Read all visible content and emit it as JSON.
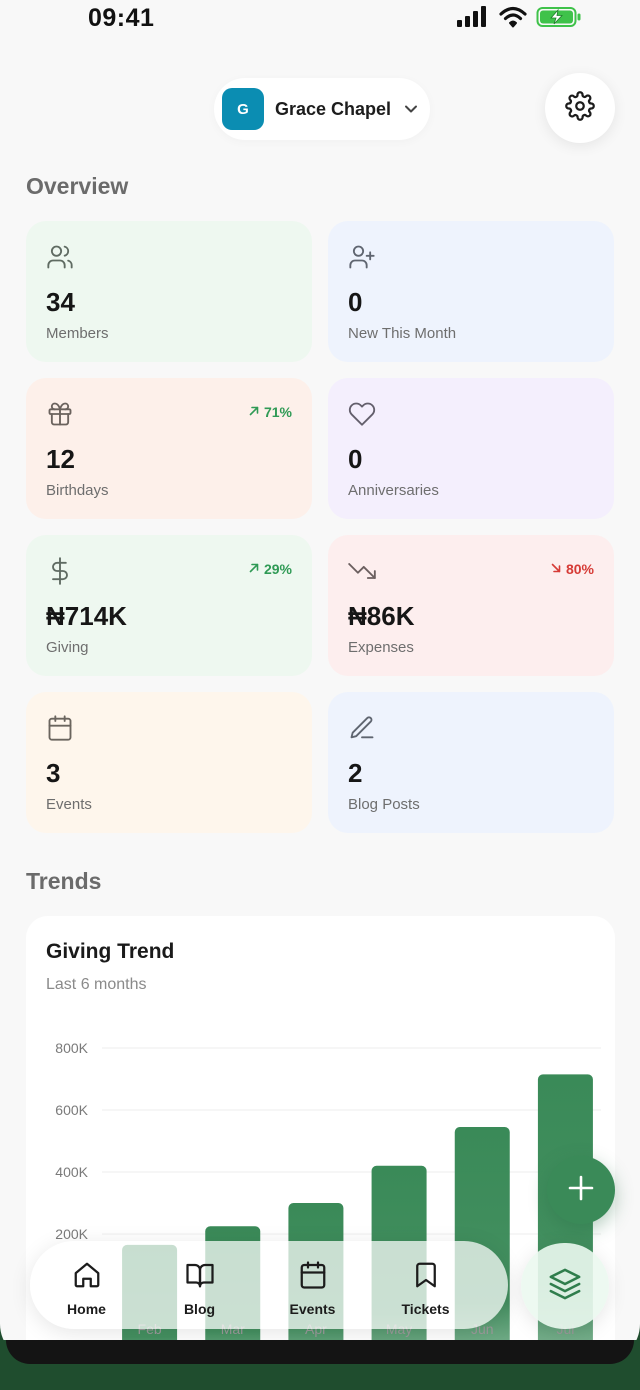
{
  "status_bar": {
    "time": "09:41"
  },
  "header": {
    "org_initial": "G",
    "org_name": "Grace Chapel"
  },
  "overview": {
    "title": "Overview",
    "cards": [
      {
        "icon": "users-icon",
        "value": "34",
        "label": "Members",
        "bg": "#eef8f0",
        "icon_color": "#5f6b62"
      },
      {
        "icon": "user-plus-icon",
        "value": "0",
        "label": "New This Month",
        "bg": "#eef3fd",
        "icon_color": "#5f6570"
      },
      {
        "icon": "gift-icon",
        "value": "12",
        "label": "Birthdays",
        "trend": "71%",
        "trend_dir": "up",
        "bg": "#fdf0ea",
        "icon_color": "#6a625d"
      },
      {
        "icon": "heart-icon",
        "value": "0",
        "label": "Anniversaries",
        "bg": "#f4effd",
        "icon_color": "#635f6c"
      },
      {
        "icon": "dollar-icon",
        "value": "₦714K",
        "label": "Giving",
        "trend": "29%",
        "trend_dir": "up",
        "bg": "#eef8f0",
        "icon_color": "#5f6b62"
      },
      {
        "icon": "trending-down-icon",
        "value": "₦86K",
        "label": "Expenses",
        "trend": "80%",
        "trend_dir": "down",
        "bg": "#fdeeee",
        "icon_color": "#6b5f5f"
      },
      {
        "icon": "calendar-icon",
        "value": "3",
        "label": "Events",
        "bg": "#fef6ec",
        "icon_color": "#6a655e"
      },
      {
        "icon": "pen-icon",
        "value": "2",
        "label": "Blog Posts",
        "bg": "#eef3fd",
        "icon_color": "#5f6570"
      }
    ]
  },
  "trends": {
    "title": "Trends",
    "chart_card_title": "Giving Trend",
    "chart_card_subtitle": "Last 6 months"
  },
  "chart_data": {
    "type": "bar",
    "title": "Giving Trend",
    "subtitle": "Last 6 months",
    "categories": [
      "Feb",
      "Mar",
      "Apr",
      "May",
      "Jun",
      "Jul"
    ],
    "values": [
      165000,
      225000,
      300000,
      420000,
      545000,
      715000
    ],
    "ylim": [
      0,
      800000
    ],
    "yticks": [
      200000,
      400000,
      600000,
      800000
    ],
    "ytick_labels": [
      "200K",
      "400K",
      "600K",
      "800K"
    ],
    "grid": true,
    "bar_color": "#3a8a58"
  },
  "bottom_nav": {
    "items": [
      {
        "label": "Home",
        "icon": "home-icon"
      },
      {
        "label": "Blog",
        "icon": "book-icon"
      },
      {
        "label": "Events",
        "icon": "calendar-icon"
      },
      {
        "label": "Tickets",
        "icon": "bookmark-icon"
      }
    ]
  },
  "colors": {
    "accent": "#3a8a58",
    "org_avatar": "#0b8db2",
    "trend_up": "#2f9a55",
    "trend_down": "#d63b36"
  }
}
